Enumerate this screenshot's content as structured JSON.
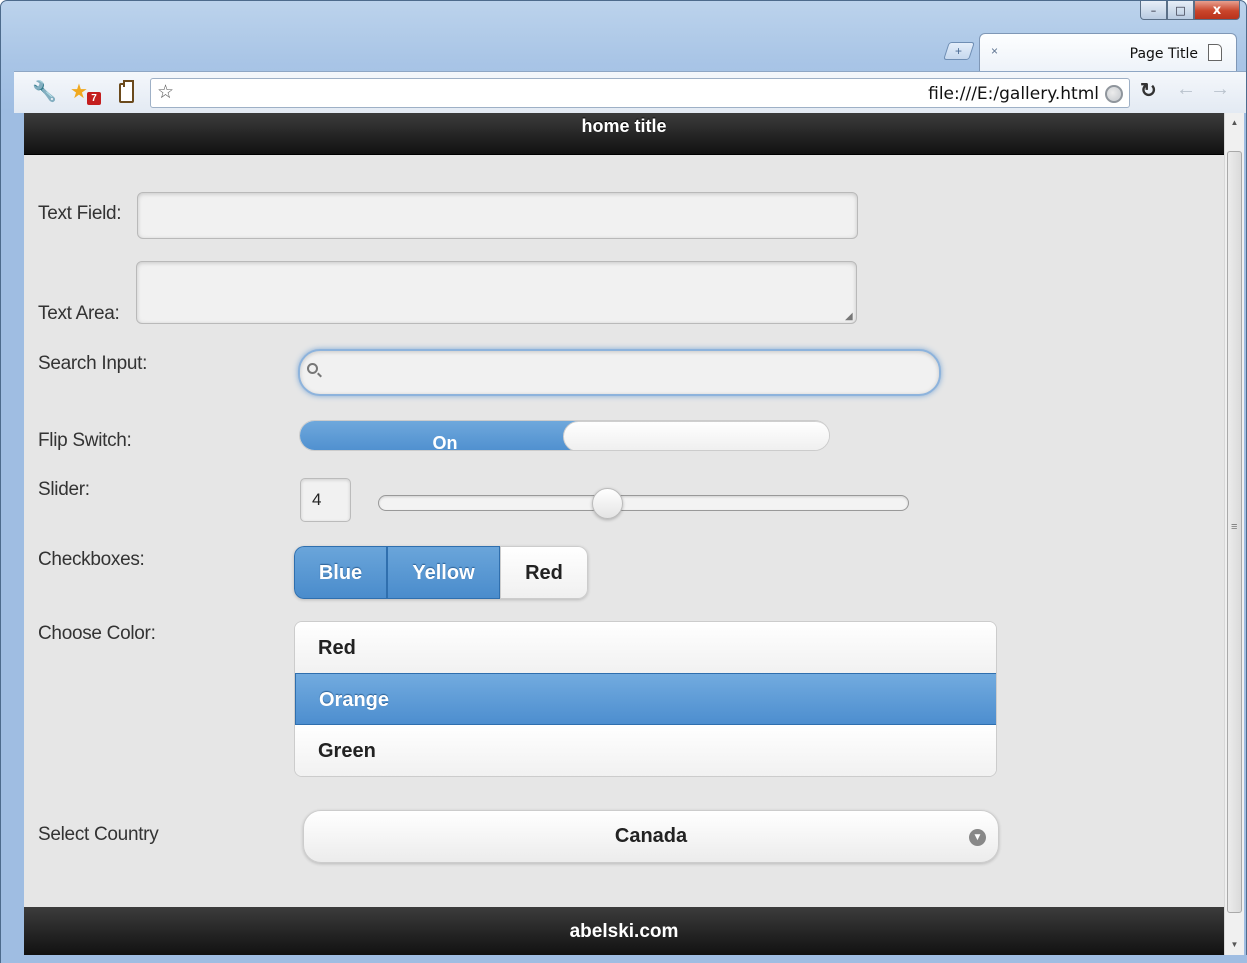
{
  "window": {
    "minimize_glyph": "–",
    "maximize_glyph": "□",
    "close_glyph": "x"
  },
  "tab": {
    "title": "Page Title",
    "new_tab_glyph": "+",
    "close_glyph": "×"
  },
  "toolbar": {
    "extension_badge": "7",
    "url": "file:///E:/gallery.html",
    "star_glyph": "☆",
    "reload_glyph": "↻",
    "back_glyph": "←",
    "forward_glyph": "→",
    "wrench_glyph": "🔧",
    "extension_glyph": "★"
  },
  "page": {
    "header_title": "home title",
    "footer_text": "abelski.com"
  },
  "form": {
    "text_field": {
      "label": "Text Field:",
      "value": ""
    },
    "text_area": {
      "label": "Text Area:",
      "value": ""
    },
    "search_input": {
      "label": "Search Input:",
      "value": ""
    },
    "flip_switch": {
      "label": "Flip Switch:",
      "state": "On"
    },
    "slider": {
      "label": "Slider:",
      "value": "4",
      "level_fraction": 0.4
    },
    "checkboxes": {
      "label": "Checkboxes:",
      "options": [
        {
          "label": "Blue",
          "checked": true
        },
        {
          "label": "Yellow",
          "checked": true
        },
        {
          "label": "Red",
          "checked": false
        }
      ]
    },
    "choose_color": {
      "label": "Choose Color:",
      "options": [
        "Red",
        "Orange",
        "Green"
      ],
      "selected": "Orange"
    },
    "select_country": {
      "label": "Select Country",
      "value": "Canada"
    }
  },
  "colors": {
    "accent": "#4e8fcf",
    "header_bg": "#1a1a1a",
    "page_bg": "#e6e6e6"
  },
  "icons": {
    "search": "search-icon",
    "dropdown": "chevron-down-icon",
    "globe": "globe-icon"
  }
}
